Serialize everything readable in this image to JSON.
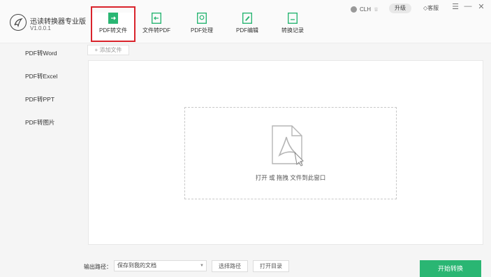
{
  "app": {
    "name": "迅读转换器专业版",
    "version": "V1.0.0.1"
  },
  "toolbar": {
    "items": [
      {
        "label": "PDF转文件",
        "icon": "file-export-icon",
        "active": true
      },
      {
        "label": "文件转PDF",
        "icon": "file-import-icon",
        "active": false
      },
      {
        "label": "PDF处理",
        "icon": "pdf-process-icon",
        "active": false
      },
      {
        "label": "PDF编辑",
        "icon": "pdf-edit-icon",
        "active": false
      },
      {
        "label": "转换记录",
        "icon": "history-icon",
        "active": false
      }
    ]
  },
  "header": {
    "username": "CLH",
    "upgrade_label": "升级",
    "service_label": "客服",
    "menu_glyph": "☰",
    "minimize_glyph": "—",
    "close_glyph": "✕"
  },
  "sidebar": {
    "items": [
      {
        "label": "PDF转Word"
      },
      {
        "label": "PDF转Excel"
      },
      {
        "label": "PDF转PPT"
      },
      {
        "label": "PDF转图片"
      }
    ]
  },
  "main": {
    "add_file_label": "+ 添加文件",
    "drop_hint": "打开 或 拖拽 文件到此窗口"
  },
  "footer": {
    "output_label": "输出路径：",
    "output_value": "保存到我的文档",
    "choose_path_label": "选择路径",
    "open_dir_label": "打开目录",
    "start_label": "开始转换"
  },
  "colors": {
    "accent": "#2ab673",
    "highlight": "#d9232b"
  }
}
